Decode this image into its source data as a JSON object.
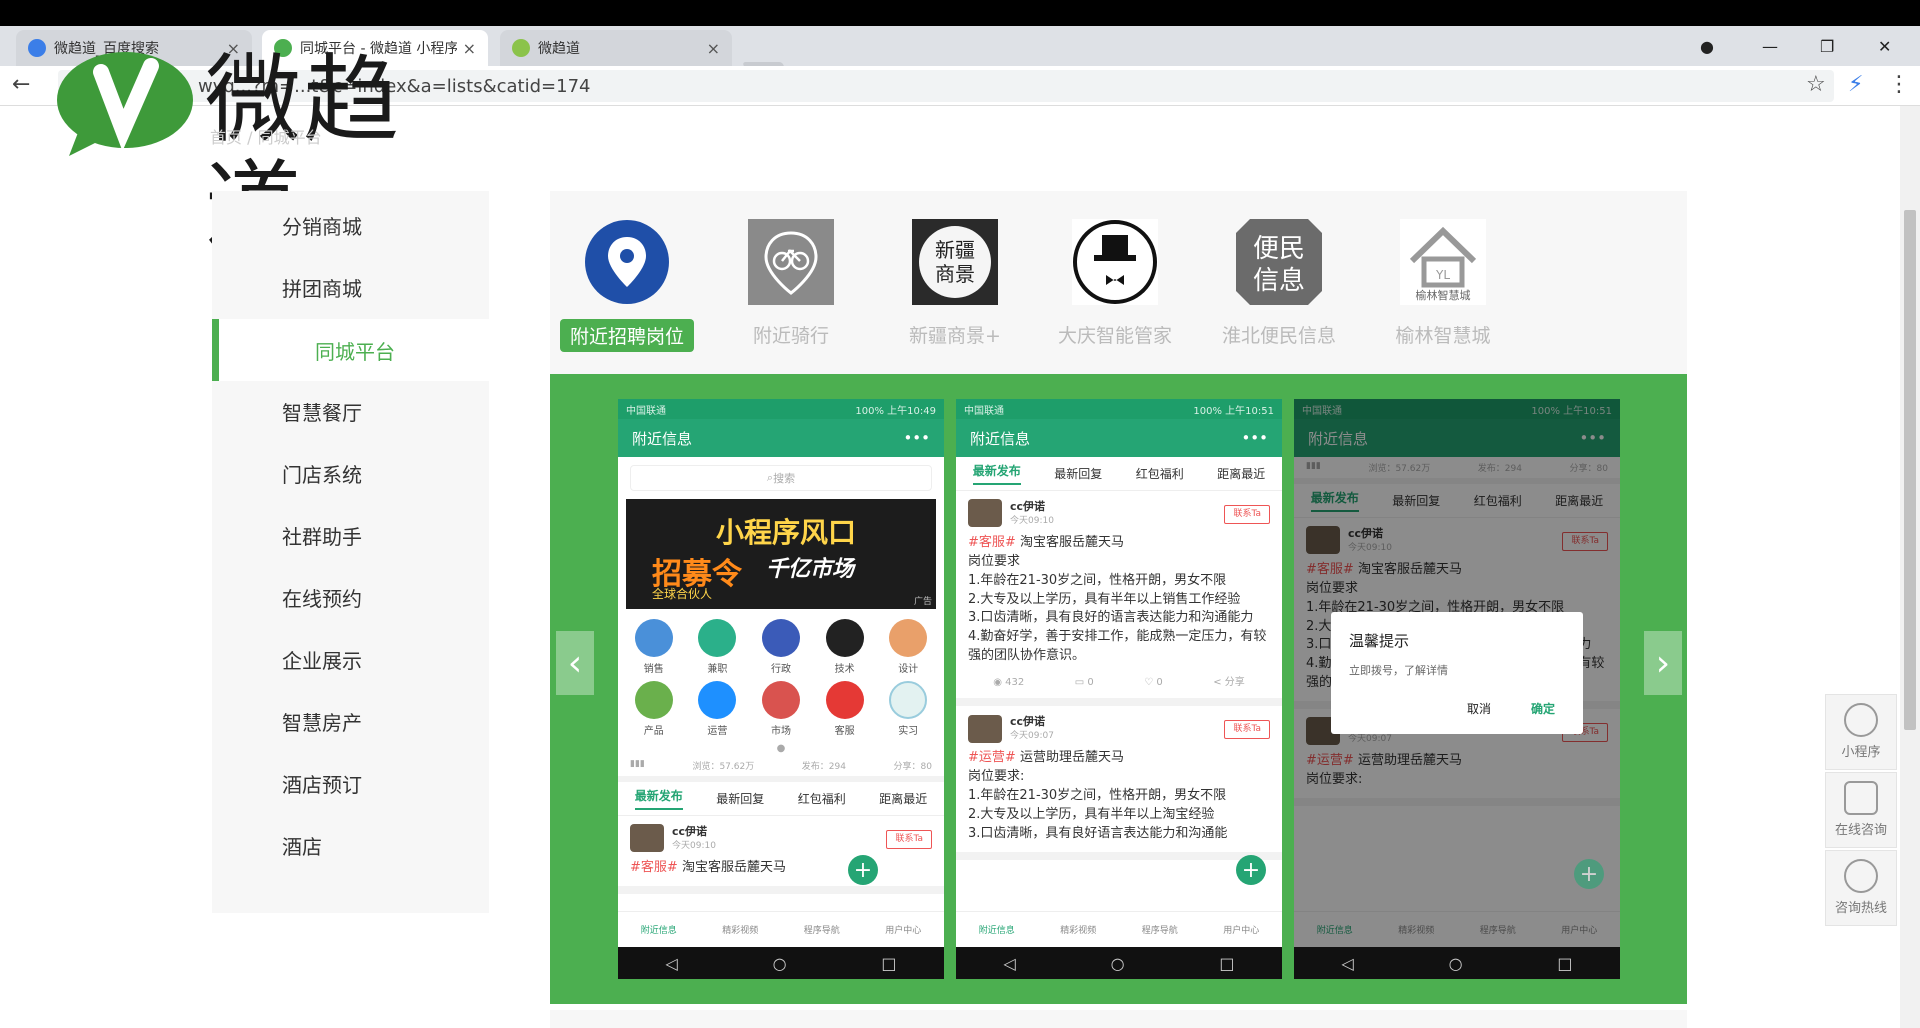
{
  "browser": {
    "tabs": [
      {
        "title": "微趋道_百度搜索"
      },
      {
        "title": "同城平台 - 微趋道 小程序"
      },
      {
        "title": "微趋道"
      }
    ],
    "url_visible": "wvq...?m=...t&c=index&a=lists&catid=174",
    "url_fragment": "&c=index&a=lists&catid=174"
  },
  "logo": {
    "text": "微趋道"
  },
  "sidebar": {
    "items": [
      {
        "label": "分销商城"
      },
      {
        "label": "拼团商城"
      },
      {
        "label": "同城平台"
      },
      {
        "label": "智慧餐厅"
      },
      {
        "label": "门店系统"
      },
      {
        "label": "社群助手"
      },
      {
        "label": "在线预约"
      },
      {
        "label": "企业展示"
      },
      {
        "label": "智慧房产"
      },
      {
        "label": "酒店预订"
      },
      {
        "label": "酒店"
      }
    ],
    "active_index": 2
  },
  "apps": [
    {
      "label": "附近招聘岗位",
      "icon": "location-pin-icon"
    },
    {
      "label": "附近骑行",
      "icon": "bicycle-icon"
    },
    {
      "label": "新疆商景+",
      "icon": "xinjiang-seal-icon"
    },
    {
      "label": "大庆智能管家",
      "icon": "butler-hat-icon"
    },
    {
      "label": "淮北便民信息",
      "icon": "bianmin-seal-icon"
    },
    {
      "label": "榆林智慧城",
      "icon": "house-logo-icon"
    }
  ],
  "phones": {
    "status_carrier": "中国联通",
    "status_right_1": "100% 上午10:49",
    "status_right_2": "100% 上午10:51",
    "title": "附近信息",
    "search_placeholder": "搜索",
    "ad": {
      "t1": "小程序风口",
      "t2": "千亿市场",
      "t3": "招募令",
      "t4": "全球合伙人",
      "tag": "广告"
    },
    "grid": [
      "销售",
      "兼职",
      "行政",
      "技术",
      "设计",
      "产品",
      "运营",
      "市场",
      "客服",
      "实习"
    ],
    "stats": {
      "browse": "浏览：57.62万",
      "post": "发布：294",
      "share": "分享：80"
    },
    "tabs": [
      "最新发布",
      "最新回复",
      "红包福利",
      "距离最近"
    ],
    "post1": {
      "name": "cc伊诺",
      "time": "今天09:10",
      "btn": "联系Ta",
      "tag": "#客服#",
      "title": "淘宝客服岳麓天马",
      "req": "岗位要求",
      "l1": "1.年龄在21-30岁之间，性格开朗，男女不限",
      "l2": "2.大专及以上学历，具有半年以上销售工作经验",
      "l3": "3.口齿清晰，具有良好的语言表达能力和沟通能力",
      "l4": "4.勤奋好学，善于安排工作，能成熟一定压力，有较强的团队协作意识。",
      "views": "432",
      "comments": "0",
      "likes": "0",
      "share": "分享"
    },
    "post2": {
      "name": "cc伊诺",
      "time": "今天09:07",
      "btn": "联系Ta",
      "tag": "#运营#",
      "title": "运营助理岳麓天马",
      "req": "岗位要求:",
      "l1": "1.年龄在21-30岁之间，性格开朗，男女不限",
      "l2": "2.大专及以上学历，具有半年以上淘宝经验",
      "l3": "3.口齿清晰，具有良好语言表达能力和沟通能"
    },
    "nav": [
      "附近信息",
      "精彩视频",
      "程序导航",
      "用户中心"
    ],
    "dialog": {
      "title": "温馨提示",
      "msg": "立即拨号，了解详情",
      "cancel": "取消",
      "ok": "确定"
    }
  },
  "float_menu": [
    {
      "label": "小程序"
    },
    {
      "label": "在线咨询"
    },
    {
      "label": "咨询热线"
    }
  ]
}
